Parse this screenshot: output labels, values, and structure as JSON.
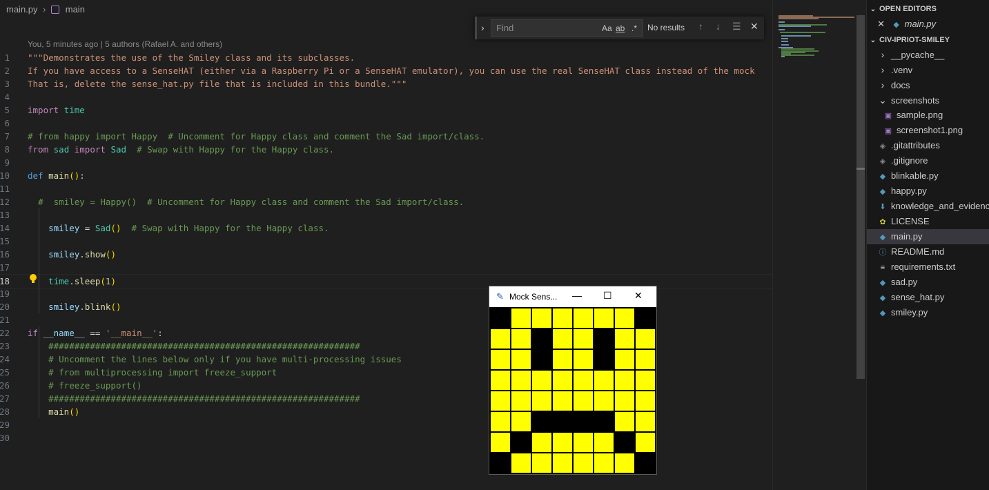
{
  "breadcrumb": {
    "file": "main.py",
    "symbol": "main"
  },
  "blame": "You, 5 minutes ago | 5 authors (Rafael A. and others)",
  "find": {
    "placeholder": "Find",
    "match_case": "Aa",
    "whole_word": "ab",
    "regex": ".*",
    "status": "No results"
  },
  "code": {
    "lines": [
      {
        "n": "1",
        "t": "\"\"\"Demonstrates the use of the Smiley class and its subclasses."
      },
      {
        "n": "2",
        "t": "If you have access to a SenseHAT (either via a Raspberry Pi or a SenseHAT emulator), you can use the real SenseHAT class instead of the mock"
      },
      {
        "n": "3",
        "t": "That is, delete the sense_hat.py file that is included in this bundle.\"\"\""
      },
      {
        "n": "4",
        "t": ""
      },
      {
        "n": "5",
        "t": "import time"
      },
      {
        "n": "6",
        "t": ""
      },
      {
        "n": "7",
        "t": "# from happy import Happy  # Uncomment for Happy class and comment the Sad import/class."
      },
      {
        "n": "8",
        "t": "from sad import Sad  # Swap with Happy for the Happy class."
      },
      {
        "n": "9",
        "t": ""
      },
      {
        "n": "10",
        "t": "def main():"
      },
      {
        "n": "11",
        "t": ""
      },
      {
        "n": "12",
        "t": "  #  smiley = Happy()  # Uncomment for Happy class and comment the Sad import/class."
      },
      {
        "n": "13",
        "t": ""
      },
      {
        "n": "14",
        "t": "    smiley = Sad()  # Swap with Happy for the Happy class."
      },
      {
        "n": "15",
        "t": ""
      },
      {
        "n": "16",
        "t": "    smiley.show()"
      },
      {
        "n": "17",
        "t": ""
      },
      {
        "n": "18",
        "t": "    time.sleep(1)"
      },
      {
        "n": "19",
        "t": ""
      },
      {
        "n": "20",
        "t": "    smiley.blink()"
      },
      {
        "n": "21",
        "t": ""
      },
      {
        "n": "22",
        "t": "if __name__ == '__main__':"
      },
      {
        "n": "23",
        "t": "    ############################################################"
      },
      {
        "n": "24",
        "t": "    # Uncomment the lines below only if you have multi-processing issues"
      },
      {
        "n": "25",
        "t": "    # from multiprocessing import freeze_support"
      },
      {
        "n": "26",
        "t": "    # freeze_support()"
      },
      {
        "n": "27",
        "t": "    ############################################################"
      },
      {
        "n": "28",
        "t": "    main()"
      },
      {
        "n": "29",
        "t": ""
      },
      {
        "n": "30",
        "t": ""
      }
    ],
    "current_line": "18"
  },
  "sidebar": {
    "open_editors_title": "OPEN EDITORS",
    "open_editors": [
      {
        "label": "main.py",
        "icon": "python-icon"
      }
    ],
    "project_title": "CIV-IPRIOT-SMILEY",
    "items": [
      {
        "label": "__pycache__",
        "type": "folder",
        "expanded": false
      },
      {
        "label": ".venv",
        "type": "folder",
        "expanded": false
      },
      {
        "label": "docs",
        "type": "folder",
        "expanded": false
      },
      {
        "label": "screenshots",
        "type": "folder",
        "expanded": true
      },
      {
        "label": "sample.png",
        "type": "image",
        "indent": true
      },
      {
        "label": "screenshot1.png",
        "type": "image",
        "indent": true
      },
      {
        "label": ".gitattributes",
        "type": "git"
      },
      {
        "label": ".gitignore",
        "type": "git"
      },
      {
        "label": "blinkable.py",
        "type": "python"
      },
      {
        "label": "happy.py",
        "type": "python"
      },
      {
        "label": "knowledge_and_evidence",
        "type": "markdown-download"
      },
      {
        "label": "LICENSE",
        "type": "license"
      },
      {
        "label": "main.py",
        "type": "python",
        "active": true
      },
      {
        "label": "README.md",
        "type": "info"
      },
      {
        "label": "requirements.txt",
        "type": "text"
      },
      {
        "label": "sad.py",
        "type": "python"
      },
      {
        "label": "sense_hat.py",
        "type": "python"
      },
      {
        "label": "smiley.py",
        "type": "python"
      }
    ]
  },
  "mock_window": {
    "title": "Mock Sens...",
    "pixels": [
      "BYYYYYYB",
      "YYBYYBYY",
      "YYBYYBYY",
      "YYYYYYYY",
      "YYYYYYYY",
      "YYBBBBYY",
      "YBYYYYBY",
      "BYYYYYYB"
    ],
    "colors": {
      "Y": "#ffff00",
      "B": "#000000"
    }
  }
}
